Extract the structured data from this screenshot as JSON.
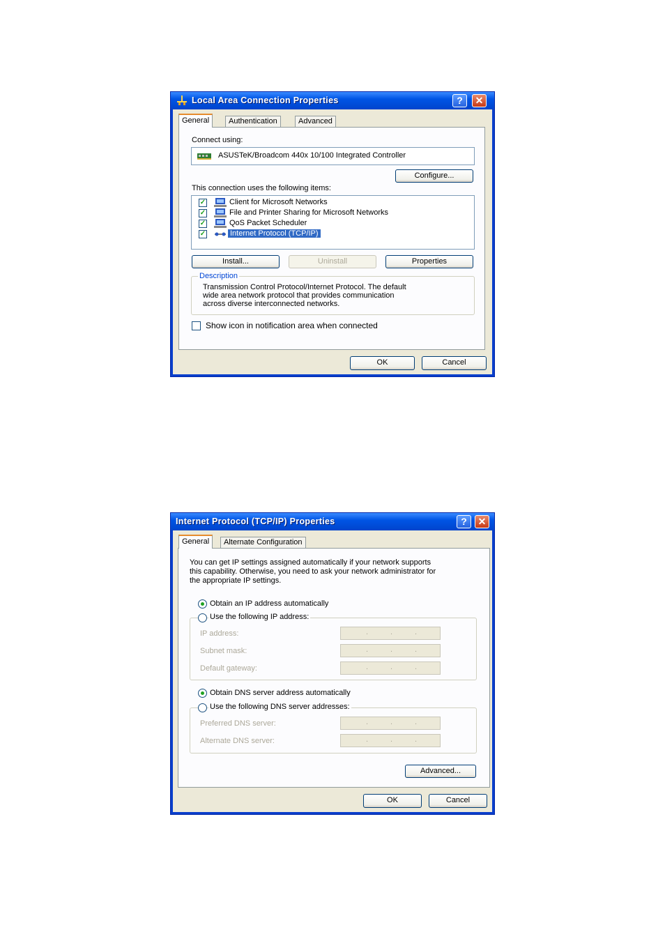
{
  "lan": {
    "title": "Local Area Connection Properties",
    "tabs": [
      "General",
      "Authentication",
      "Advanced"
    ],
    "connect_using_label": "Connect using:",
    "adapter": "ASUSTeK/Broadcom 440x 10/100 Integrated Controller",
    "configure": "Configure...",
    "items_label": "This connection uses the following items:",
    "items": [
      {
        "label": "Client for Microsoft Networks",
        "checked": true,
        "icon": "network-client-icon"
      },
      {
        "label": "File and Printer Sharing for Microsoft Networks",
        "checked": true,
        "icon": "file-printer-sharing-icon"
      },
      {
        "label": "QoS Packet Scheduler",
        "checked": true,
        "icon": "qos-scheduler-icon"
      },
      {
        "label": "Internet Protocol (TCP/IP)",
        "checked": true,
        "selected": true,
        "icon": "protocol-icon"
      }
    ],
    "install": "Install...",
    "uninstall": "Uninstall",
    "properties": "Properties",
    "description_title": "Description",
    "description_lines": [
      "Transmission Control Protocol/Internet Protocol. The default",
      "wide area network protocol that provides communication",
      "across diverse interconnected networks."
    ],
    "show_icon": "Show icon in notification area when connected",
    "ok": "OK",
    "cancel": "Cancel"
  },
  "tcpip": {
    "title": "Internet Protocol (TCP/IP) Properties",
    "tabs": [
      "General",
      "Alternate Configuration"
    ],
    "intro_lines": [
      "You can get IP settings assigned automatically if your network supports",
      "this capability. Otherwise, you need to ask your network administrator for",
      "the appropriate IP settings."
    ],
    "obtain_ip": "Obtain an IP address automatically",
    "use_ip": "Use the following IP address:",
    "ip_address": "IP address:",
    "subnet_mask": "Subnet mask:",
    "default_gateway": "Default gateway:",
    "obtain_dns": "Obtain DNS server address automatically",
    "use_dns": "Use the following DNS server addresses:",
    "preferred_dns": "Preferred DNS server:",
    "alternate_dns": "Alternate DNS server:",
    "ip_dot": ".",
    "advanced": "Advanced...",
    "ok": "OK",
    "cancel": "Cancel"
  },
  "colors": {
    "title_blue": "#0055E5",
    "dialog_bg": "#ECE9D8",
    "selection": "#316AC5",
    "radio_dot": "#21A121"
  }
}
